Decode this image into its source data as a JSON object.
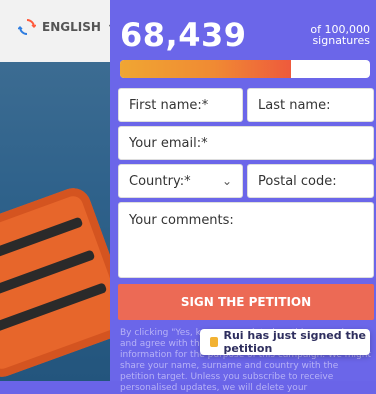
{
  "language": {
    "label": "ENGLISH"
  },
  "counter": {
    "value": "68,439",
    "goal_line1": "of 100,000",
    "goal_line2": "signatures",
    "progress_fraction": 0.68439
  },
  "form": {
    "first_name_placeholder": "First name:*",
    "last_name_placeholder": "Last name:",
    "email_placeholder": "Your email:*",
    "country_placeholder": "Country:*",
    "postal_code_placeholder": "Postal code:",
    "comments_placeholder": "Your comments:",
    "submit_label": "SIGN THE PETITION"
  },
  "fineprint": "By clicking \"Yes, keep me updated on this campaign, and agree with the petition terms\" we collect information for the purpose of this campaign. We might share your name, surname and country with the petition target. Unless you subscribe to receive personalised updates, we will delete your",
  "toast": {
    "text": "Rui has just signed the petition"
  },
  "colors": {
    "panel": "#6b66e9",
    "button": "#ec6a55",
    "progress_start": "#f0a633",
    "progress_end": "#ee5a3c"
  }
}
